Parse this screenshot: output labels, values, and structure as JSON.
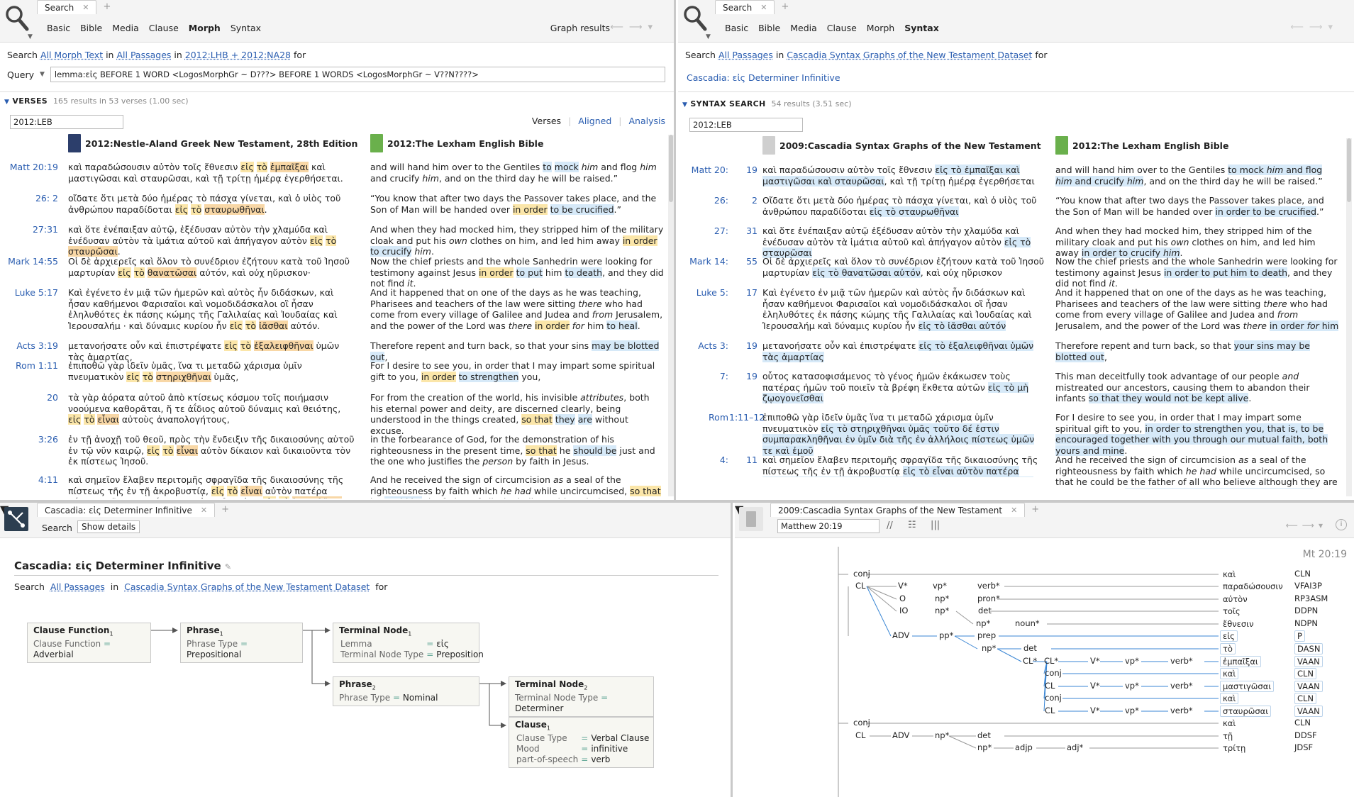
{
  "left_search": {
    "tab_label": "Search",
    "subnav": [
      "Basic",
      "Bible",
      "Media",
      "Clause",
      "Morph",
      "Syntax"
    ],
    "current": "Morph",
    "graph_results": "Graph results",
    "line": {
      "prefix": "Search",
      "morph": "All Morph Text",
      "in1": "in",
      "passages": "All Passages",
      "in2": "in",
      "versions": "2012:LHB + 2012:NA28",
      "for": "for"
    },
    "query_label": "Query",
    "query": "lemma:εἰς BEFORE 1 WORD <LogosMorphGr ~ D???> BEFORE 1 WORDS <LogosMorphGr ~ V??N????>",
    "section": "VERSES",
    "section_meta": "165 results in 53 verses (1.00 sec)",
    "version_box": "2012:LEB",
    "view_tabs": [
      "Verses",
      "Aligned",
      "Analysis"
    ],
    "col1": "2012:Nestle-Aland Greek New Testament, 28th Edition",
    "col2": "2012:The Lexham English Bible",
    "rows": [
      {
        "ref": "Matt 20:19",
        "gk": "καὶ παραδώσουσιν αὐτὸν τοῖς ἔθνεσιν <y>εἰς</y> <y>τὸ</y> <o>ἐμπαῖξαι</o> καὶ μαστιγῶσαι καὶ σταυρῶσαι, καὶ τῇ τρίτῃ ἡμέρᾳ ἐγερθήσεται.",
        "en": "and will hand him over to the Gentiles <b>to</b> <b>mock</b> <i>him</i> and flog <i>him</i> and crucify <i>him</i>, and on the third day he will be raised.”"
      },
      {
        "ref": "26: 2",
        "gk": "οἴδατε ὅτι μετὰ δύο ἡμέρας τὸ πάσχα γίνεται, καὶ ὁ υἱὸς τοῦ ἀνθρώπου παραδίδοται <y>εἰς</y> <y>τὸ</y> <o>σταυρωθῆναι</o>.",
        "en": "“You know that after two days the Passover takes place, and the Son of Man will be handed over <y>in order</y> <b>to be crucified</b>.”"
      },
      {
        "ref": "27:31",
        "gk": "καὶ ὅτε ἐνέπαιξαν αὐτῷ, ἐξέδυσαν αὐτὸν τὴν χλαμύδα καὶ ἐνέδυσαν αὐτὸν τὰ ἱμάτια αὐτοῦ καὶ ἀπήγαγον αὐτὸν <y>εἰς</y> <y>τὸ</y> <o>σταυρῶσαι</o>.",
        "en": "And when they had mocked him, they stripped him of the military cloak and put his <i>own</i> clothes on him, and led him away <y>in order</y> <b>to crucify</b> <i>him</i>."
      },
      {
        "ref": "Mark 14:55",
        "gk": "Οἱ δὲ ἀρχιερεῖς καὶ ὅλον τὸ συνέδριον ἐζήτουν κατὰ τοῦ Ἰησοῦ μαρτυρίαν <y>εἰς</y> <y>τὸ</y> <o>θανατῶσαι</o> αὐτόν, καὶ οὐχ ηὕρισκον·",
        "en": "Now the chief priests and the whole Sanhedrin were looking for testimony against Jesus <y>in order</y> <b>to put</b> him <b>to death</b>, and they did not find <i>it</i>."
      },
      {
        "ref": "Luke 5:17",
        "gk": "Καὶ ἐγένετο ἐν μιᾷ τῶν ἡμερῶν καὶ αὐτὸς ἦν διδάσκων, καὶ ἦσαν καθήμενοι Φαρισαῖοι καὶ νομοδιδάσκαλοι οἳ ἦσαν ἐληλυθότες ἐκ πάσης κώμης τῆς Γαλιλαίας καὶ Ἰουδαίας καὶ Ἰερουσαλήμ · καὶ δύναμις κυρίου ἦν <y>εἰς</y> <y>τὸ</y> <o>ἰᾶσθαι</o> αὐτόν.",
        "en": "And it happened that on one of the days as he was teaching, Pharisees and teachers of the law were sitting <i>there</i> who had come from every village of Galilee and Judea and <i>from</i> Jerusalem, and the power of the Lord was <i>there</i> <y>in order</y> <i>for</i> him <b>to heal</b>."
      },
      {
        "ref": "Acts 3:19",
        "gk": "μετανοήσατε οὖν καὶ ἐπιστρέψατε <y>εἰς</y> <y>τὸ</y> <o>ἐξαλειφθῆναι</o> ὑμῶν τὰς ἁμαρτίας,",
        "en": "Therefore repent and turn back, so that your sins <b>may be blotted out</b>,"
      },
      {
        "ref": "Rom 1:11",
        "gk": "ἐπιποθῶ γὰρ ἰδεῖν ὑμᾶς, ἵνα τι μεταδῶ χάρισμα ὑμῖν πνευματικὸν <y>εἰς</y> <y>τὸ</y> <o>στηριχθῆναι</o> ὑμᾶς,",
        "en": "For I desire to see you, in order that I may impart some spiritual gift to you, <y>in order</y> <b>to strengthen</b> you,"
      },
      {
        "ref": "20",
        "gk": "τὰ γὰρ ἀόρατα αὐτοῦ ἀπὸ κτίσεως κόσμου τοῖς ποιήμασιν νοούμενα καθορᾶται, ἥ τε ἀΐδιος αὐτοῦ δύναμις καὶ θειότης, <y>εἰς</y> <y>τὸ</y> <o>εἶναι</o> αὐτοὺς ἀναπολογήτους,",
        "en": "For from the creation of the world, his invisible <i>attributes</i>, both his eternal power and deity, are discerned clearly, being understood in the things created, <y>so that</y> <b>they</b> <b>are</b> without excuse."
      },
      {
        "ref": "3:26",
        "gk": "ἐν τῇ ἀνοχῇ τοῦ θεοῦ, πρὸς τὴν ἔνδειξιν τῆς δικαιοσύνης αὐτοῦ ἐν τῷ νῦν καιρῷ, <y>εἰς</y> <y>τὸ</y> <o>εἶναι</o> αὐτὸν δίκαιον καὶ δικαιοῦντα τὸν ἐκ πίστεως Ἰησοῦ.",
        "en": "in the forbearance of God, for the demonstration of his righteousness in the present time, <y>so that</y> he <b>should be</b> just and the one who justifies the <i>person</i> by faith in Jesus."
      },
      {
        "ref": "4:11",
        "gk": "καὶ σημεῖον ἔλαβεν περιτομῆς σφραγῖδα τῆς δικαιοσύνης τῆς πίστεως τῆς ἐν τῇ ἀκροβυστίᾳ, <y>εἰς</y> <y>τὸ</y> <o>εἶναι</o> αὐτὸν πατέρα πάντων τῶν πιστευόντων δι’ ἀκροβυστίας, <y>εἰς</y> <y>τὸ</y> <o>λογισθῆναι</o> [καὶ] αὐτοῖς [τὴν] δικαιοσύνην,",
        "en": "And he received the sign of circumcision <i>as</i> a seal of the righteousness by faith which <i>he had</i> while uncircumcised, <y>so that</y> he <b>could be</b> the father of all who believe although they are uncircumcised, <y>so that</y> <b>righteousness could</b>"
      }
    ]
  },
  "right_search": {
    "tab_label": "Search",
    "subnav": [
      "Basic",
      "Bible",
      "Media",
      "Clause",
      "Morph",
      "Syntax"
    ],
    "current": "Syntax",
    "line": {
      "prefix": "Search",
      "passages": "All Passages",
      "in1": "in",
      "dataset": "Cascadia Syntax Graphs of the New Testament Dataset",
      "for": "for"
    },
    "query_link": "Cascadia: εἰς Determiner Infinitive",
    "section": "SYNTAX SEARCH",
    "section_meta": "54 results (3.51 sec)",
    "version_box": "2012:LEB",
    "col1": "2009:Cascadia Syntax Graphs of the New Testament",
    "col2": "2012:The Lexham English Bible",
    "rows": [
      {
        "ref": "Matt 20:",
        "num": "19",
        "gk": "καὶ παραδώσουσιν αὐτὸν τοῖς ἔθνεσιν <b>εἰς τὸ ἐμπαῖξαι καὶ μαστιγῶσαι καὶ σταυρῶσαι</b>, καὶ τῇ τρίτῃ ἡμέρᾳ ἐγερθήσεται",
        "en": "and will hand him over to the Gentiles <b>to mock <i>him</i> and flog <i>him</i> and crucify <i>him</i></b>, and on the third day he will be raised.”"
      },
      {
        "ref": "26:",
        "num": "2",
        "gk": "Οἴδατε ὅτι μετὰ δύο ἡμέρας τὸ πάσχα γίνεται, καὶ ὁ υἱὸς τοῦ ἀνθρώπου παραδίδοται <b>εἰς τὸ σταυρωθῆναι</b>",
        "en": "“You know that after two days the Passover takes place, and the Son of Man will be handed over <b>in order to be crucified</b>.”"
      },
      {
        "ref": "27:",
        "num": "31",
        "gk": "καὶ ὅτε ἐνέπαιξαν αὐτῷ ἐξέδυσαν αὐτὸν τὴν χλαμύδα καὶ ἐνέδυσαν αὐτὸν τὰ ἱμάτια αὐτοῦ καὶ ἀπήγαγον αὐτὸν <b>εἰς τὸ σταυρῶσαι</b>",
        "en": "And when they had mocked him, they stripped him of the military cloak and put his <i>own</i> clothes on him, and led him away <b>in order to crucify <i>him</i></b>."
      },
      {
        "ref": "Mark 14:",
        "num": "55",
        "gk": "Οἱ δὲ ἀρχιερεῖς καὶ ὅλον τὸ συνέδριον ἐζήτουν κατὰ τοῦ Ἰησοῦ μαρτυρίαν <b>εἰς τὸ θανατῶσαι αὐτόν</b>, καὶ οὐχ ηὕρισκον",
        "en": "Now the chief priests and the whole Sanhedrin were looking for testimony against Jesus <b>in order to put him to death</b>, and they did not find <i>it</i>."
      },
      {
        "ref": "Luke 5:",
        "num": "17",
        "gk": "Καὶ ἐγένετο ἐν μιᾷ τῶν ἡμερῶν καὶ αὐτὸς ἦν διδάσκων καὶ ἦσαν καθήμενοι Φαρισαῖοι καὶ νομοδιδάσκαλοι οἳ ἦσαν ἐληλυθότες ἐκ πάσης κώμης τῆς Γαλιλαίας καὶ Ἰουδαίας καὶ Ἰερουσαλήμ καὶ δύναμις κυρίου ἦν <b>εἰς τὸ ἰᾶσθαι αὐτόν</b>",
        "en": "And it happened that on one of the days as he was teaching, Pharisees and teachers of the law were sitting <i>there</i> who had come from every village of Galilee and Judea and <i>from</i> Jerusalem, and the power of the Lord was <i>there</i> <b>in order <i>for</i> him to heal</b>."
      },
      {
        "ref": "Acts 3:",
        "num": "19",
        "gk": "μετανοήσατε οὖν καὶ ἐπιστρέψατε <b>εἰς τὸ ἐξαλειφθῆναι ὑμῶν τὰς ἁμαρτίας</b>",
        "en": "Therefore repent and turn back, so that <b>your sins may be blotted out</b>,"
      },
      {
        "ref": "7:",
        "num": "19",
        "gk": "οὗτος κατασοφισάμενος τὸ γένος ἡμῶν ἐκάκωσεν τοὺς πατέρας ἡμῶν τοῦ ποιεῖν τὰ βρέφη ἔκθετα αὐτῶν <b>εἰς τὸ μὴ ζῳογονεῖσθαι</b>",
        "en": "This man deceitfully took advantage of our people <i>and</i> mistreated our ancestors, causing them to abandon their infants <b>so that they would not be kept alive</b>."
      },
      {
        "ref": "Rom",
        "num": "1:11–12",
        "gk": "ἐπιποθῶ γὰρ ἰδεῖν ὑμᾶς ἵνα τι μεταδῶ χάρισμα ὑμῖν πνευματικὸν <b>εἰς τὸ στηριχθῆναι ὑμᾶς τοῦτο δέ ἐστιν συμπαρακληθῆναι ἐν ὑμῖν διὰ τῆς ἐν ἀλλήλοις πίστεως ὑμῶν τε καὶ ἐμοῦ</b>",
        "en": "For I desire to see you, in order that I may impart some spiritual gift to you, <b>in order to strengthen you, that is, to be encouraged together with you through our mutual faith, both yours and mine</b>."
      },
      {
        "ref": "4:",
        "num": "11",
        "gk": "καὶ σημεῖον ἔλαβεν περιτομῆς σφραγῖδα τῆς δικαιοσύνης τῆς πίστεως τῆς ἐν τῇ ἀκροβυστίᾳ <b>εἰς τὸ εἶναι αὐτὸν πατέρα πάντων τῶν πιστευόντων δι’ ἀκροβυστίας εἰς τὸ λογισθῆναι καὶ αὐτοῖς τὴν δικαιοσύνην</b>",
        "en": "And he received the sign of circumcision <i>as</i> a seal of the righteousness by faith which <i>he had</i> while uncircumcised, so that he could be the father of all who believe although they are uncircumcised, <b>so that righteousness could be credited to them</b>,"
      }
    ]
  },
  "query_editor": {
    "tab_label": "Cascadia: εἰς Determiner Infinitive",
    "subnav": [
      "Search"
    ],
    "show_details": "Show details",
    "title": "Cascadia: εἰς Determiner Infinitive",
    "search_line": {
      "prefix": "Search",
      "passages": "All Passages",
      "in": "in",
      "dataset": "Cascadia Syntax Graphs of the New Testament Dataset",
      "for": "for"
    },
    "nodes": {
      "clause_function": {
        "title": "Clause Function",
        "sub": "1",
        "rows": [
          [
            "Clause Function",
            "=",
            "Adverbial"
          ]
        ]
      },
      "phrase1": {
        "title": "Phrase",
        "sub": "1",
        "rows": [
          [
            "Phrase Type",
            "=",
            "Prepositional"
          ]
        ]
      },
      "terminal1": {
        "title": "Terminal Node",
        "sub": "1",
        "rows": [
          [
            "Lemma",
            "=",
            "εἰς"
          ],
          [
            "Terminal Node Type",
            "=",
            "Preposition"
          ]
        ]
      },
      "phrase2": {
        "title": "Phrase",
        "sub": "2",
        "rows": [
          [
            "Phrase Type",
            "=",
            "Nominal"
          ]
        ]
      },
      "terminal2": {
        "title": "Terminal Node",
        "sub": "2",
        "rows": [
          [
            "Terminal Node Type",
            "=",
            "Determiner"
          ]
        ]
      },
      "clause1": {
        "title": "Clause",
        "sub": "1",
        "rows": [
          [
            "Clause Type",
            "=",
            "Verbal Clause"
          ],
          [
            "Mood",
            "=",
            "infinitive"
          ],
          [
            "part-of-speech",
            "=",
            "verb"
          ]
        ]
      }
    }
  },
  "syntax_graph": {
    "tab_label": "2009:Cascadia Syntax Graphs of the New Testament",
    "ref_box": "Matthew 20:19",
    "verse_label": "Mt 20:19",
    "labels": [
      "conj",
      "CL",
      "V*",
      "vp*",
      "verb*",
      "O",
      "np*",
      "pron*",
      "IO",
      "np*",
      "det",
      "np*",
      "noun*",
      "ADV",
      "pp*",
      "prep",
      "np*",
      "det",
      "CL*",
      "CL*",
      "V*",
      "vp*",
      "verb*",
      "conj",
      "CL",
      "V*",
      "vp*",
      "verb*",
      "conj",
      "CL",
      "V*",
      "vp*",
      "verb*",
      "conj",
      "CL",
      "ADV",
      "np*",
      "det",
      "np*",
      "adjp",
      "adj*"
    ],
    "words": [
      "καὶ",
      "παραδώσουσιν",
      "αὐτὸν",
      "τοῖς",
      "ἔθνεσιν",
      "εἰς",
      "τὸ",
      "ἐμπαῖξαι",
      "καὶ",
      "μαστιγῶσαι",
      "καὶ",
      "σταυρῶσαι",
      "καὶ",
      "τῇ",
      "τρίτῃ"
    ],
    "tags": [
      "CLN",
      "VFAI3P",
      "RP3ASM",
      "DDPN",
      "NDPN",
      "P",
      "DASN",
      "VAAN",
      "CLN",
      "VAAN",
      "CLN",
      "VAAN",
      "CLN",
      "DDSF",
      "JDSF"
    ]
  }
}
